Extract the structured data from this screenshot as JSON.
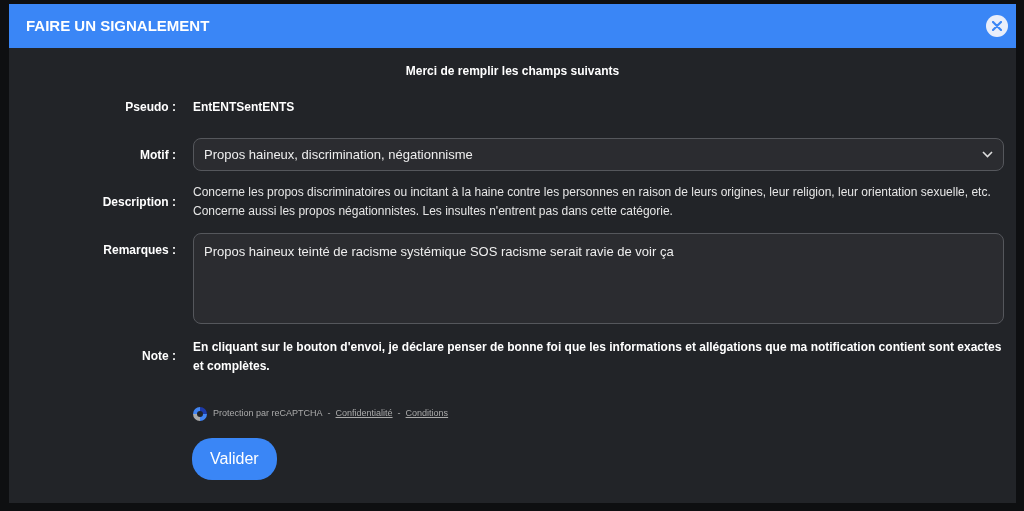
{
  "modal": {
    "title": "FAIRE UN SIGNALEMENT"
  },
  "intro": "Merci de remplir les champs suivants",
  "fields": [
    {
      "kind": "static",
      "label": "Pseudo :",
      "value": "EntENTSentENTS"
    },
    {
      "kind": "select",
      "label": "Motif :",
      "value": "Propos haineux, discrimination, négationnisme"
    },
    {
      "kind": "text",
      "label": "Description :",
      "value": "Concerne les propos discriminatoires ou incitant à la haine contre les personnes en raison de leurs origines, leur religion, leur orientation sexuelle, etc. Concerne aussi les propos négationnistes. Les insultes n'entrent pas dans cette catégorie."
    },
    {
      "kind": "textarea",
      "label": "Remarques :",
      "value": "Propos haineux teinté de racisme systémique SOS racisme serait ravie de voir ça"
    },
    {
      "kind": "note",
      "label": "Note :",
      "value": "En cliquant sur le bouton d'envoi, je déclare penser de bonne foi que les informations et allégations que ma notification contient sont exactes et complètes."
    }
  ],
  "recaptcha": {
    "text": "Protection par reCAPTCHA",
    "sep1": "-",
    "privacy": "Confidentialité",
    "sep2": "-",
    "terms": "Conditions"
  },
  "submit": "Valider"
}
